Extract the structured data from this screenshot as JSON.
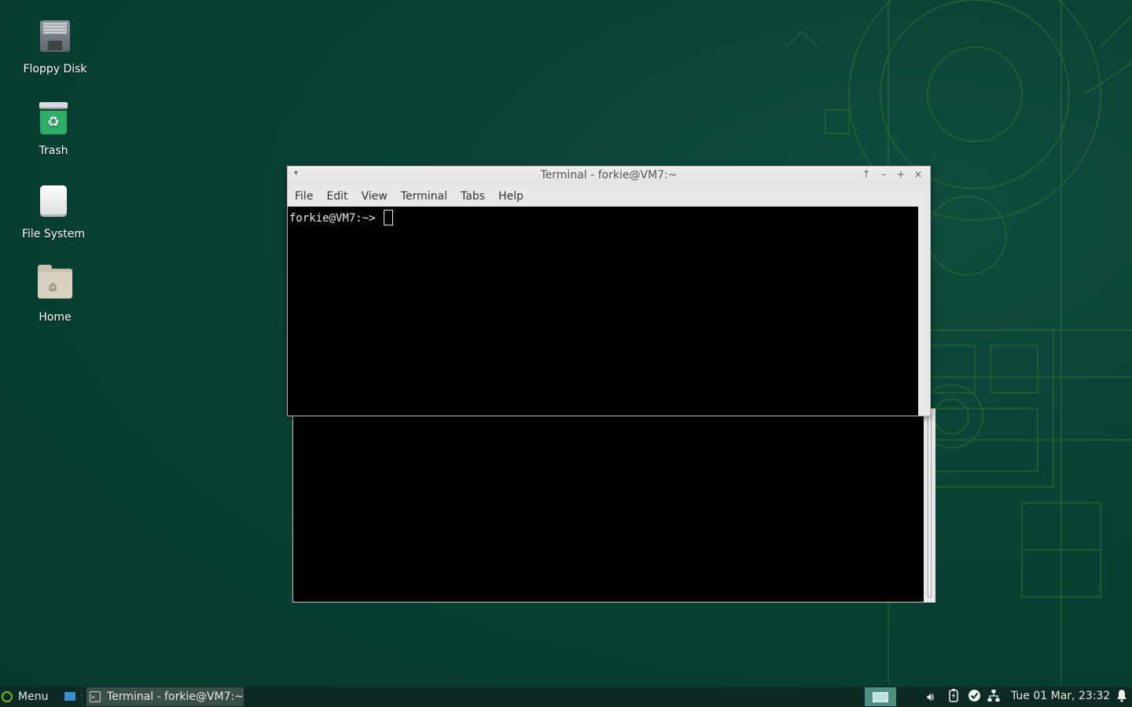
{
  "desktop": {
    "icons": [
      {
        "label": "Floppy Disk",
        "icon": "floppy-disk-icon"
      },
      {
        "label": "Trash",
        "icon": "trash-icon"
      },
      {
        "label": "File System",
        "icon": "drive-icon"
      },
      {
        "label": "Home",
        "icon": "home-folder-icon"
      }
    ],
    "background_color": "#0a4234"
  },
  "terminal": {
    "title": "Terminal - forkie@VM7:~",
    "window_buttons": {
      "menu": "▾",
      "raise": "↑",
      "minimize": "–",
      "maximize": "+",
      "close": "×"
    },
    "menu": [
      "File",
      "Edit",
      "View",
      "Terminal",
      "Tabs",
      "Help"
    ],
    "prompt": "forkie@VM7:~> "
  },
  "taskbar": {
    "menu_label": "Menu",
    "task_title": "Terminal - forkie@VM7:~",
    "clock": "Tue 01 Mar, 23:32",
    "tray_icons": [
      "volume-icon",
      "power-icon",
      "updates-check-icon",
      "network-icon",
      "notifications-bell-icon"
    ],
    "accent_color": "#73ba25"
  }
}
